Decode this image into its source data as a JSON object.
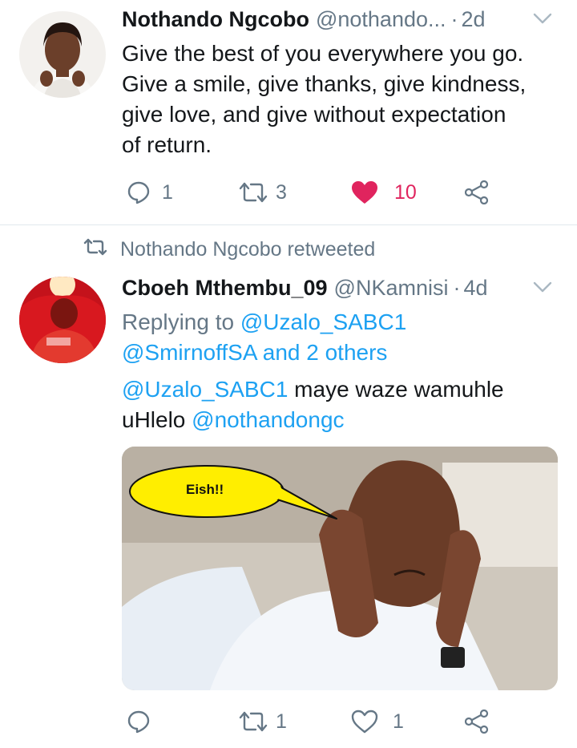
{
  "tweet1": {
    "author_name": "Nothando Ngcobo",
    "handle": "@nothando...",
    "separator": "·",
    "time": "2d",
    "lines": [
      "Give the best of you everywhere you go.",
      "Give a smile, give thanks, give kindness,",
      "give love, and give without expectation",
      "of return."
    ],
    "reply_count": "1",
    "retweet_count": "3",
    "like_count": "10",
    "liked": true
  },
  "tweet2": {
    "retweeted_by": "Nothando Ngcobo retweeted",
    "author_name": "Cboeh Mthembu_09",
    "handle": "@NKamnisi",
    "separator": "·",
    "time": "4d",
    "replying_prefix": "Replying to",
    "replying_user1": "@Uzalo_SABC1",
    "replying_user2": "@SmirnoffSA",
    "replying_suffix": "and 2 others",
    "text_mention1": "@Uzalo_SABC1",
    "text_part1": " maye waze wamuhle",
    "text_part2": "uHlelo ",
    "text_mention2": "@nothandongc",
    "media_caption": "Eish!!",
    "reply_count": "",
    "retweet_count": "1",
    "like_count": "1"
  },
  "colors": {
    "link": "#1da1f2",
    "muted": "#657786",
    "like": "#e0245e",
    "speech_bubble": "#ffee00"
  }
}
